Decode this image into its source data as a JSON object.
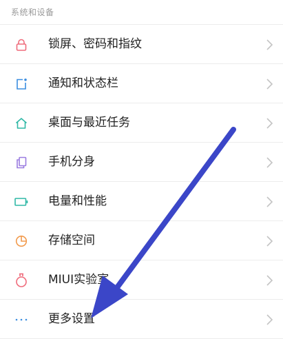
{
  "section": {
    "title": "系统和设备"
  },
  "items": [
    {
      "label": "锁屏、密码和指纹",
      "icon": "lock-icon",
      "color": "#ef6b7b"
    },
    {
      "label": "通知和状态栏",
      "icon": "notification-icon",
      "color": "#3a8de0"
    },
    {
      "label": "桌面与最近任务",
      "icon": "home-icon",
      "color": "#2fb8a6"
    },
    {
      "label": "手机分身",
      "icon": "phone-clone-icon",
      "color": "#9a7be0"
    },
    {
      "label": "电量和性能",
      "icon": "battery-icon",
      "color": "#2fb8a6"
    },
    {
      "label": "存储空间",
      "icon": "storage-pie-icon",
      "color": "#f29a4c"
    },
    {
      "label": "MIUI实验室",
      "icon": "lab-flask-icon",
      "color": "#ef6b7b"
    },
    {
      "label": "更多设置",
      "icon": "more-dots-icon",
      "color": "#3a8de0"
    }
  ],
  "annotation": {
    "arrow_color": "#3b46c8"
  }
}
